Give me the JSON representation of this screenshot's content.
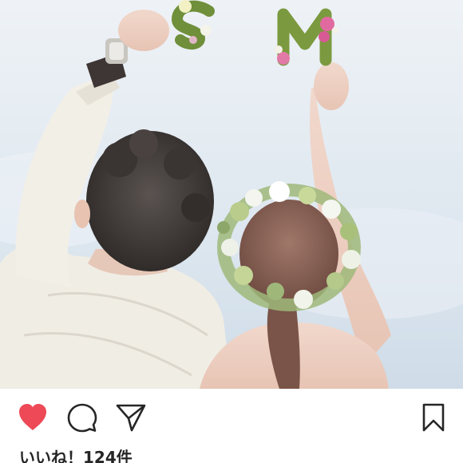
{
  "post": {
    "photo": {
      "letters": [
        "S",
        "M"
      ]
    },
    "actions": {
      "like_icon": "heart-filled-icon",
      "comment_icon": "speech-bubble-icon",
      "share_icon": "paper-plane-icon",
      "save_icon": "bookmark-icon",
      "like_color": "#ed4956",
      "icon_color": "#262626"
    },
    "likes_text": "いいね！124件"
  }
}
